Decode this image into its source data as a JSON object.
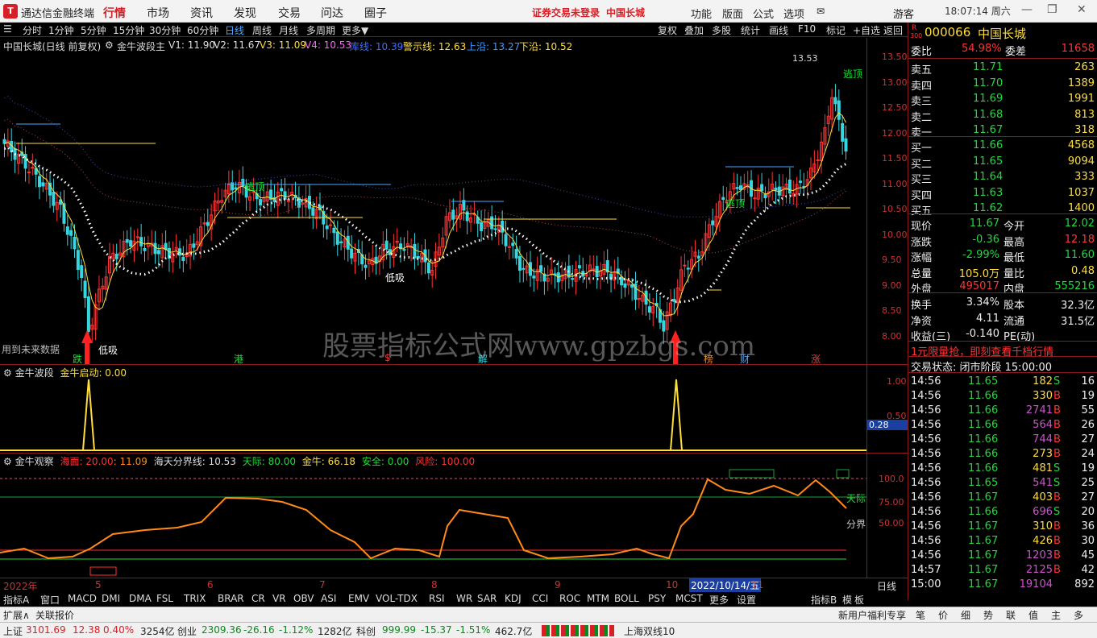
{
  "app": {
    "title": "通达信金融终端",
    "logo": "T"
  },
  "menus": [
    "行情",
    "市场",
    "资讯",
    "发现",
    "交易",
    "问达",
    "圈子"
  ],
  "warn": [
    "证券交易未登录",
    "中国长城"
  ],
  "rmenus": [
    "功能",
    "版面",
    "公式",
    "选项"
  ],
  "user": "游客",
  "time": "18:07:14 周六",
  "toolbar": {
    "left": [
      "分时",
      "1分钟",
      "5分钟",
      "15分钟",
      "30分钟",
      "60分钟",
      "日线",
      "周线",
      "月线",
      "多周期",
      "更多▼"
    ],
    "right": [
      "复权",
      "叠加",
      "多股",
      "统计",
      "画线",
      "F10",
      "标记",
      "+自选",
      "返回"
    ]
  },
  "chartinfo": {
    "name": "中国长城(日线 前复权)",
    "ind": "金牛波段主",
    "v1": "V1: 11.90",
    "v2": "V2: 11.67",
    "v3": "V3: 11.09",
    "v4": "V4: 10.53",
    "ku": "库线: 10.39",
    "jing": "警示线: 12.63",
    "shang": "上沿: 13.27",
    "xia": "下沿: 10.52"
  },
  "main_y": [
    "13.50",
    "13.00",
    "12.50",
    "12.00",
    "11.50",
    "11.00",
    "10.50",
    "10.00",
    "9.50",
    "9.00",
    "8.50",
    "8.00"
  ],
  "annot": {
    "high": "13.53",
    "top1": "逃顶",
    "top2": "逃顶",
    "top3": "逃顶",
    "low1": "低吸",
    "low2": "低吸",
    "future": "用到未来数据",
    "watermark": "股票指标公式网www.gpzbgs.com"
  },
  "signals": [
    "跌",
    "港",
    "$",
    "解",
    "榜",
    "财",
    "涨"
  ],
  "pane2": {
    "title": "金牛波段",
    "sub": "金牛启动: 0.00",
    "y": [
      "1.00",
      "0.50"
    ],
    "box": "0.28"
  },
  "pane3": {
    "title": "金牛观察",
    "hai": "海面: 20.00",
    "hai2": ": 11.09",
    "fen": "海天分界线: 10.53",
    "tian": "天际: 80.00",
    "jn": "金牛: 66.18",
    "aq": "安全: 0.00",
    "fx": "风险: 100.00",
    "y": [
      "100.0",
      "75.00",
      "50.00"
    ],
    "tj": "天际",
    "fj": "分界"
  },
  "xaxis": {
    "year": "2022年",
    "m": [
      "5",
      "6",
      "7",
      "8",
      "9",
      "10",
      "11"
    ],
    "date": "2022/10/14/五",
    "period": "日线"
  },
  "bottom": [
    "指标A",
    "窗口",
    "MACD",
    "DMI",
    "DMA",
    "FSL",
    "TRIX",
    "BRAR",
    "CR",
    "VR",
    "OBV",
    "ASI",
    "EMV",
    "VOL-TDX",
    "RSI",
    "WR",
    "SAR",
    "KDJ",
    "CCI",
    "ROC",
    "MTM",
    "BOLL",
    "PSY",
    "MCST",
    "更多",
    "设置"
  ],
  "bottom_r": [
    "指标B",
    "模",
    "板"
  ],
  "tab2": {
    "a": "扩展∧",
    "b": "关联报价",
    "r": "新用户福利专享"
  },
  "quote": {
    "code": "000066",
    "name": "中国长城",
    "rtag": "R",
    "sub": "300",
    "wb": "委比",
    "wbv": "54.98%",
    "wc": "委差",
    "wcv": "11658",
    "sell": [
      [
        "卖五",
        "11.71",
        "263"
      ],
      [
        "卖四",
        "11.70",
        "1389"
      ],
      [
        "卖三",
        "11.69",
        "1991"
      ],
      [
        "卖二",
        "11.68",
        "813"
      ],
      [
        "卖一",
        "11.67",
        "318"
      ]
    ],
    "buy": [
      [
        "买一",
        "11.66",
        "4568"
      ],
      [
        "买二",
        "11.65",
        "9094"
      ],
      [
        "买三",
        "11.64",
        "333"
      ],
      [
        "买四",
        "11.63",
        "1037"
      ],
      [
        "买五",
        "11.62",
        "1400"
      ]
    ],
    "stats": [
      [
        "现价",
        "11.67",
        "今开",
        "12.02"
      ],
      [
        "涨跌",
        "-0.36",
        "最高",
        "12.18"
      ],
      [
        "涨幅",
        "-2.99%",
        "最低",
        "11.60"
      ],
      [
        "总量",
        "105.0万",
        "量比",
        "0.48"
      ],
      [
        "外盘",
        "495017",
        "内盘",
        "555216"
      ]
    ],
    "stats2": [
      [
        "换手",
        "3.34%",
        "股本",
        "32.3亿"
      ],
      [
        "净资",
        "4.11",
        "流通",
        "31.5亿"
      ],
      [
        "收益(三)",
        "-0.140",
        "PE(动)",
        ""
      ]
    ],
    "promo": "1元限量抢，即刻查看千档行情",
    "state": "交易状态: 闭市阶段 15:00:00",
    "ticks": [
      [
        "14:56",
        "11.65",
        "182",
        "S",
        "16"
      ],
      [
        "14:56",
        "11.66",
        "330",
        "B",
        "19"
      ],
      [
        "14:56",
        "11.66",
        "2741",
        "B",
        "55"
      ],
      [
        "14:56",
        "11.66",
        "564",
        "B",
        "26"
      ],
      [
        "14:56",
        "11.66",
        "744",
        "B",
        "27"
      ],
      [
        "14:56",
        "11.66",
        "273",
        "B",
        "24"
      ],
      [
        "14:56",
        "11.66",
        "481",
        "S",
        "19"
      ],
      [
        "14:56",
        "11.65",
        "541",
        "S",
        "25"
      ],
      [
        "14:56",
        "11.67",
        "403",
        "B",
        "27"
      ],
      [
        "14:56",
        "11.66",
        "696",
        "S",
        "20"
      ],
      [
        "14:56",
        "11.67",
        "310",
        "B",
        "36"
      ],
      [
        "14:56",
        "11.67",
        "426",
        "B",
        "30"
      ],
      [
        "14:56",
        "11.67",
        "1203",
        "B",
        "45"
      ],
      [
        "14:57",
        "11.67",
        "2125",
        "B",
        "42"
      ],
      [
        "15:00",
        "11.67",
        "19104",
        "",
        "892"
      ]
    ]
  },
  "rtabs": [
    "笔",
    "价",
    "细",
    "势",
    "联",
    "值",
    "主",
    "多"
  ],
  "status": {
    "sh": "上证",
    "shv": "3101.69",
    "shc": "12.38",
    "shp": "0.40%",
    "sha": "3254亿",
    "cy": "创业",
    "cyv": "2309.36",
    "cyc": "-26.16",
    "cyp": "-1.12%",
    "cya": "1282亿",
    "kc": "科创",
    "kcv": "999.99",
    "kcc": "-15.37",
    "kcp": "-1.51%",
    "kca": "462.7亿",
    "line": "上海双线10"
  },
  "colors": {
    "up": "#ff3434",
    "down": "#36d6e0",
    "ma": "#ffde3a",
    "orange": "#ff8a1a"
  }
}
